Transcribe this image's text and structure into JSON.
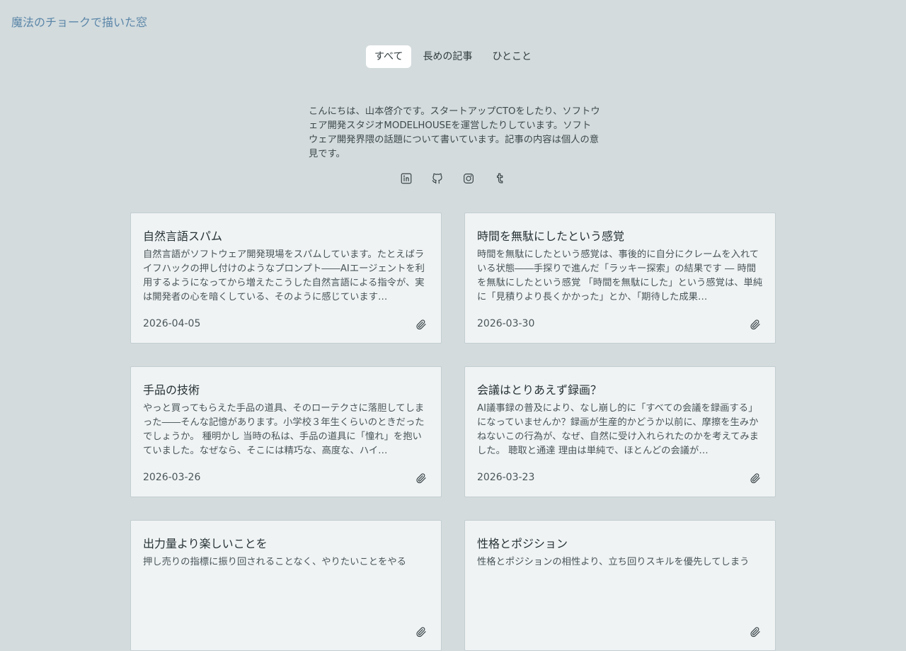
{
  "site": {
    "title": "魔法のチョークで描いた窓"
  },
  "tabs": [
    {
      "label": "すべて",
      "active": true
    },
    {
      "label": "長めの記事",
      "active": false
    },
    {
      "label": "ひとこと",
      "active": false
    }
  ],
  "intro": {
    "text": "こんにちは、山本啓介です。スタートアップCTOをしたり、ソフトウェア開発スタジオMODELHOUSEを運営したりしています。ソフトウェア開発界隈の話題について書いています。記事の内容は個人の意見です。"
  },
  "social": [
    {
      "icon": "linkedin-icon"
    },
    {
      "icon": "github-icon"
    },
    {
      "icon": "instagram-icon"
    },
    {
      "icon": "tumblr-icon"
    }
  ],
  "posts": [
    {
      "title": "自然言語スパム",
      "excerpt": "自然言語がソフトウェア開発現場をスパムしています。たとえばライフハックの押し付けのようなプロンプト――AIエージェントを利用するようになってから増えたこうした自然言語による指令が、実は開発者の心を暗くしている、そのように感じています…",
      "date": "2026-04-05",
      "icon": "paperclip-icon"
    },
    {
      "title": "時間を無駄にしたという感覚",
      "excerpt": "時間を無駄にしたという感覚は、事後的に自分にクレームを入れている状態――手探りで進んだ「ラッキー探索」の結果です ― 時間を無駄にしたという感覚 「時間を無駄にした」という感覚は、単純に「見積りより長くかかった」とか、「期待した成果…",
      "date": "2026-03-30",
      "icon": "paperclip-icon"
    },
    {
      "title": "手品の技術",
      "excerpt": "やっと買ってもらえた手品の道具、そのローテクさに落胆してしまった――そんな記憶があります。小学校３年生くらいのときだったでしょうか。 種明かし 当時の私は、手品の道具に「憧れ」を抱いていました。なぜなら、そこには精巧な、高度な、ハイ…",
      "date": "2026-03-26",
      "icon": "paperclip-icon"
    },
    {
      "title": "会議はとりあえず録画？",
      "excerpt": "AI議事録の普及により、なし崩し的に「すべての会議を録画する」になっていませんか？録画が生産的かどうか以前に、摩擦を生みかねないこの行為が、なぜ、自然に受け入れられたのかを考えてみました。 聴取と通達 理由は単純で、ほとんどの会議が…",
      "date": "2026-03-23",
      "icon": "paperclip-icon"
    },
    {
      "title": "出力量より楽しいことを",
      "excerpt": "押し売りの指標に振り回されることなく、やりたいことをやる",
      "date": "",
      "icon": "paperclip-icon"
    },
    {
      "title": "性格とポジション",
      "excerpt": "性格とポジションの相性より、立ち回りスキルを優先してしまう",
      "date": "",
      "icon": "paperclip-icon"
    }
  ]
}
